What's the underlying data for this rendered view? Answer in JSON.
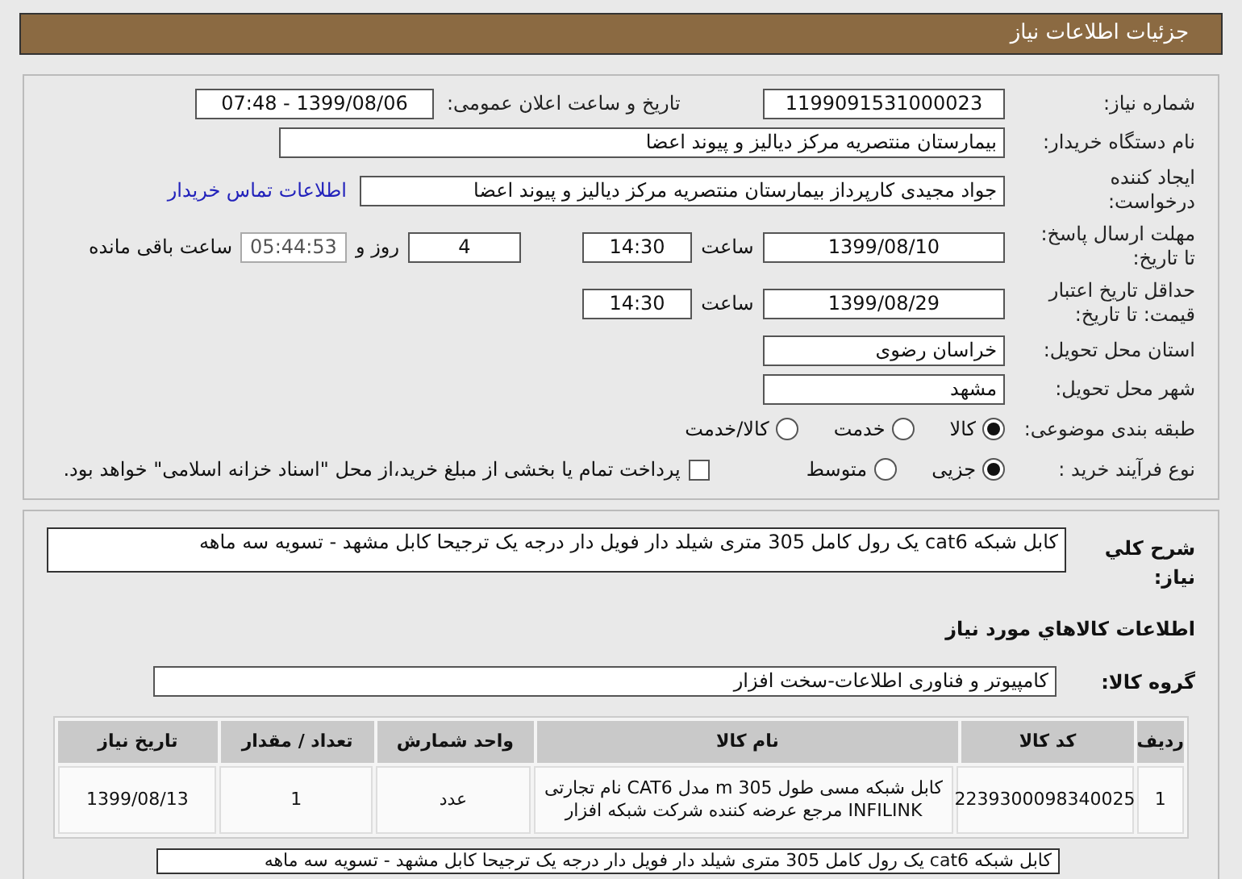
{
  "header": {
    "title": "جزئیات اطلاعات نیاز"
  },
  "need_number": {
    "label": "شماره نیاز:",
    "value": "1199091531000023"
  },
  "announce": {
    "label": "تاریخ و ساعت اعلان عمومی:",
    "value": "1399/08/06 - 07:48"
  },
  "buyer": {
    "label": "نام دستگاه خریدار:",
    "value": "بیمارستان منتصریه مرکز دیالیز و پیوند اعضا"
  },
  "creator": {
    "label": "ایجاد کننده درخواست:",
    "value": "جواد مجیدی کارپرداز بیمارستان منتصریه مرکز دیالیز و پیوند اعضا",
    "link": "اطلاعات تماس خریدار"
  },
  "deadline": {
    "label": "مهلت ارسال پاسخ: تا تاریخ:",
    "date": "1399/08/10",
    "time_label": "ساعت",
    "time": "14:30",
    "days": "4",
    "days_label": "روز و",
    "remaining": "05:44:53",
    "remaining_label": "ساعت باقی مانده"
  },
  "validity": {
    "label": "حداقل تاریخ اعتبار قیمت: تا تاریخ:",
    "date": "1399/08/29",
    "time_label": "ساعت",
    "time": "14:30"
  },
  "province": {
    "label": "استان محل تحویل:",
    "value": "خراسان رضوی"
  },
  "city": {
    "label": "شهر محل تحویل:",
    "value": "مشهد"
  },
  "category": {
    "label": "طبقه بندی موضوعی:",
    "options": [
      {
        "label": "کالا",
        "selected": true
      },
      {
        "label": "خدمت",
        "selected": false
      },
      {
        "label": "کالا/خدمت",
        "selected": false
      }
    ]
  },
  "process": {
    "label": "نوع فرآیند خرید :",
    "options": [
      {
        "label": "جزیی",
        "selected": true
      },
      {
        "label": "متوسط",
        "selected": false
      }
    ],
    "payment": {
      "checked": false,
      "text": "پرداخت تمام یا بخشی از مبلغ خرید،از محل \"اسناد خزانه اسلامی\" خواهد بود."
    }
  },
  "description": {
    "label": "شرح کلي نیاز:",
    "value": "کابل شبکه cat6 یک رول کامل 305 متری شیلد دار فویل دار درجه یک ترجیحا کابل مشهد - تسویه سه ماهه"
  },
  "goods_title": "اطلاعات کالاهاي مورد نیاز",
  "group": {
    "label": "گروه کالا:",
    "value": "کامپیوتر و فناوری اطلاعات-سخت افزار"
  },
  "table": {
    "columns": [
      "ردیف",
      "کد کالا",
      "نام کالا",
      "واحد شمارش",
      "تعداد / مقدار",
      "تاریخ نیاز"
    ],
    "rows": [
      [
        "1",
        "2239300098340025",
        "کابل شبکه مسی طول 305 m مدل CAT6 نام تجارتی INFILINK مرجع عرضه کننده شرکت شبکه افزار",
        "عدد",
        "1",
        "1399/08/13"
      ]
    ]
  },
  "footer_note": "کابل شبکه cat6 یک رول کامل 305 متری شیلد دار فویل دار درجه یک ترجیحا کابل مشهد - تسویه سه ماهه"
}
